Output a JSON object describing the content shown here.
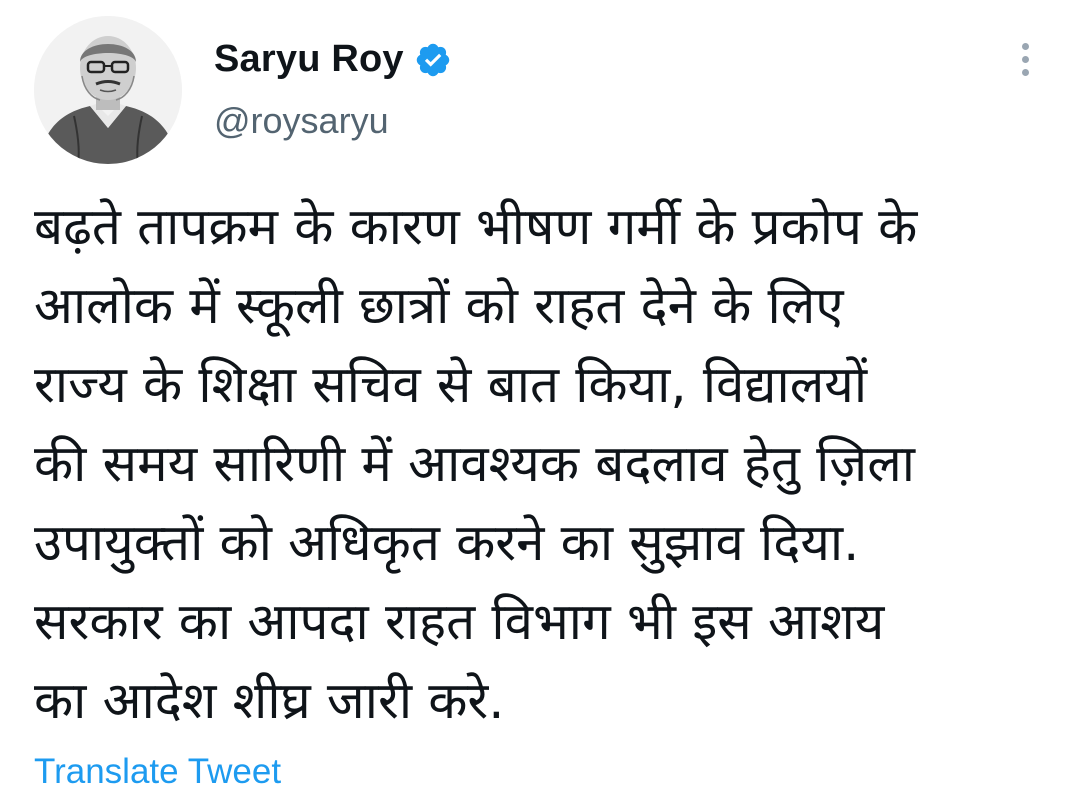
{
  "author": {
    "display_name": "Saryu Roy",
    "handle": "@roysaryu",
    "verified": true,
    "avatar_icon": "avatar-portrait-sketch"
  },
  "menu": {
    "icon": "more-vertical-icon"
  },
  "tweet": {
    "lines": [
      "बढ़ते तापक्रम के कारण भीषण गर्मी के प्रकोप के",
      "आलोक में स्कूली छात्रों को राहत देने के लिए",
      "राज्य के शिक्षा सचिव से बात किया, विद्यालयों",
      "की समय सारिणी में आवश्यक बदलाव हेतु ज़िला",
      "उपायुक्तों को अधिकृत करने का सुझाव दिया.",
      "सरकार का आपदा राहत विभाग भी इस आशय",
      "का आदेश शीघ्र जारी करे."
    ]
  },
  "translate_label": "Translate Tweet",
  "colors": {
    "verified_badge": "#1d9bf0",
    "link": "#1d9bf0",
    "secondary_text": "#536471",
    "primary_text": "#0f1419"
  }
}
